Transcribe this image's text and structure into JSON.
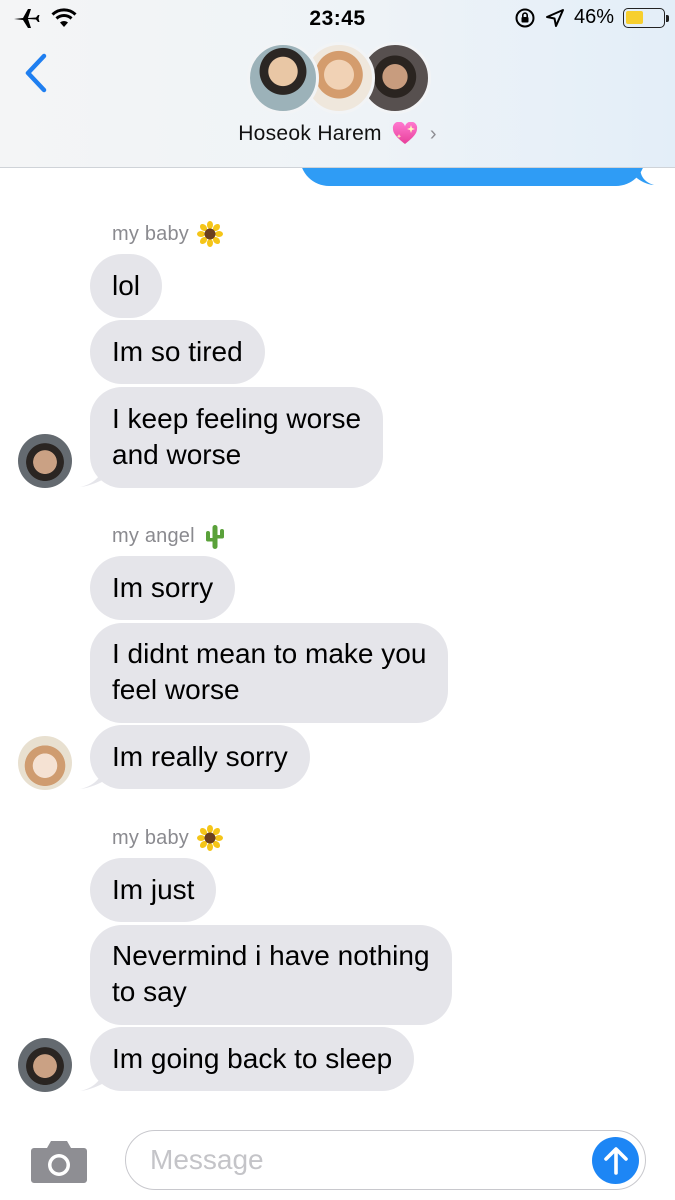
{
  "status_bar": {
    "time": "23:45",
    "battery_percent": "46%",
    "battery_level": 0.46,
    "icons": [
      "airplane-icon",
      "wifi-icon",
      "orientation-lock-icon",
      "location-icon",
      "battery-icon"
    ]
  },
  "header": {
    "group_name": "Hoseok Harem",
    "group_emoji": "sparkling-heart-icon",
    "back_icon": "chevron-left-icon"
  },
  "thread": {
    "groups": [
      {
        "sender": "my baby",
        "sender_emoji": "sunflower-icon",
        "messages": [
          "lol",
          "Im so tired",
          "I keep feeling worse\nand worse"
        ]
      },
      {
        "sender": "my angel",
        "sender_emoji": "cactus-icon",
        "messages": [
          "Im sorry",
          "I didnt mean to make you\nfeel worse",
          "Im really sorry"
        ]
      },
      {
        "sender": "my baby",
        "sender_emoji": "sunflower-icon",
        "messages": [
          "Im just",
          "Nevermind i have nothing\nto say",
          "Im going back to sleep"
        ]
      }
    ]
  },
  "composer": {
    "placeholder": "Message",
    "camera_icon": "camera-icon",
    "send_icon": "arrow-up-icon"
  },
  "colors": {
    "incoming_bubble": "#e5e5ea",
    "outgoing_bubble": "#2f9cf5",
    "send_button": "#1d86f5",
    "back_chevron": "#1f7ff0",
    "sender_label": "#8a8a8f"
  }
}
